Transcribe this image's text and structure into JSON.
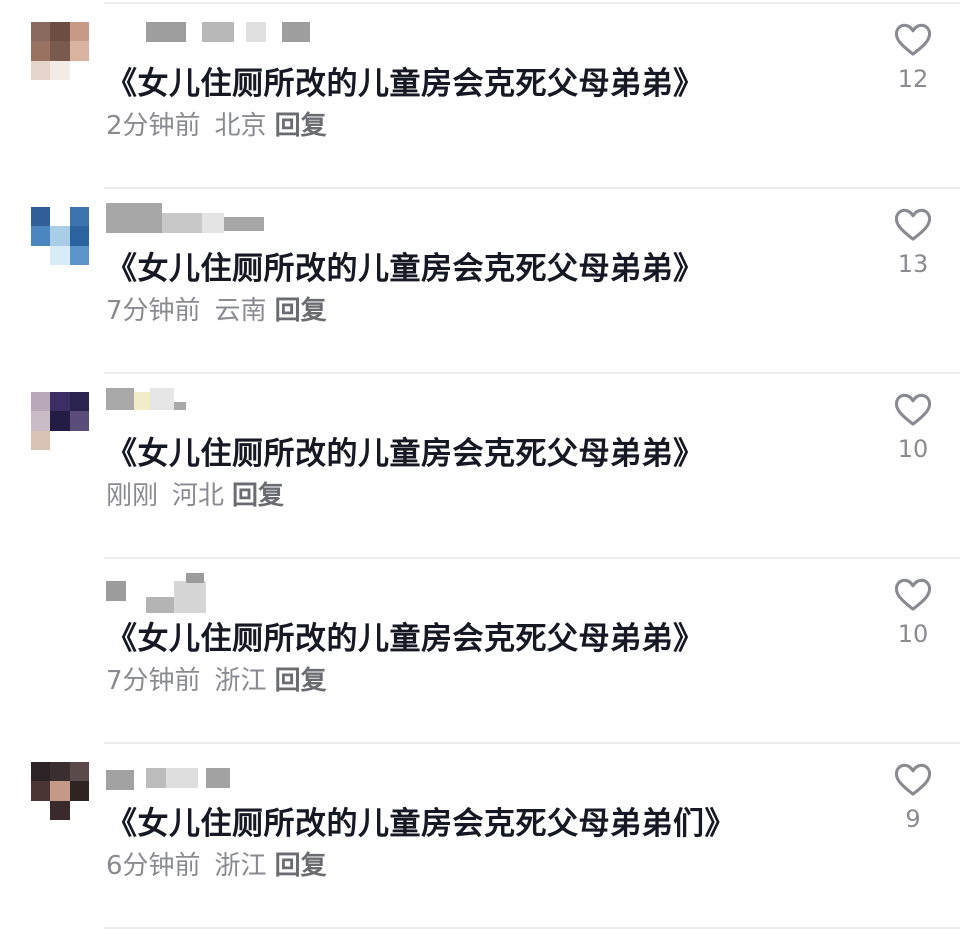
{
  "comments": [
    {
      "content": "《女儿住厕所改的儿童房会克死父母弟弟》",
      "time": "2分钟前",
      "location": "北京",
      "reply": "回复",
      "likes": "12",
      "icon": "heart-outline-icon",
      "avatar_colors": [
        "#8a6a5e",
        "#6e4e42",
        "#c79a86",
        "#9a7262",
        "#7a5a4e",
        "#d9b3a0",
        "#e6d5cc",
        "#f3ebe6",
        "#ffffff"
      ],
      "name_colors": [
        "#9e9e9e",
        "#b8b8b8",
        "#e0e0e0"
      ]
    },
    {
      "content": "《女儿住厕所改的儿童房会克死父母弟弟》",
      "time": "7分钟前",
      "location": "云南",
      "reply": "回复",
      "likes": "13",
      "icon": "heart-outline-icon",
      "avatar_colors": [
        "#2f5f96",
        "#ffffff",
        "#3c74ad",
        "#4b86c0",
        "#a9cde6",
        "#2b62a0",
        "#ffffff",
        "#d9ebf6",
        "#5c93c8"
      ],
      "name_colors": [
        "#a7a7a7",
        "#c8c8c8",
        "#e4e4e4"
      ]
    },
    {
      "content": "《女儿住厕所改的儿童房会克死父母弟弟》",
      "time": "刚刚",
      "location": "河北",
      "reply": "回复",
      "likes": "10",
      "icon": "heart-outline-icon",
      "avatar_colors": [
        "#b9a9b8",
        "#3b2e63",
        "#2a2350",
        "#c9bcc6",
        "#231c45",
        "#5a4d7a",
        "#d8c2b4",
        "#ffffff",
        "#ffffff"
      ],
      "name_colors": [
        "#a9a9a9",
        "#f2ecc8",
        "#e6e6e6"
      ]
    },
    {
      "content": "《女儿住厕所改的儿童房会克死父母弟弟》",
      "time": "7分钟前",
      "location": "浙江",
      "reply": "回复",
      "likes": "10",
      "icon": "heart-outline-icon",
      "avatar_colors": [
        "#ffffff",
        "#ffffff",
        "#ffffff",
        "#ffffff",
        "#ffffff",
        "#ffffff",
        "#ffffff",
        "#ffffff",
        "#ffffff"
      ],
      "name_colors": [
        "#9c9c9c",
        "#b4b4b4",
        "#d6d6d6"
      ]
    },
    {
      "content": "《女儿住厕所改的儿童房会克死父母弟弟们》",
      "time": "6分钟前",
      "location": "浙江",
      "reply": "回复",
      "likes": "9",
      "icon": "heart-outline-icon",
      "avatar_colors": [
        "#2b2326",
        "#3a2e30",
        "#5a4a4c",
        "#4a3434",
        "#c49a86",
        "#2e2424",
        "#ffffff",
        "#3a2a2c",
        "#ffffff"
      ],
      "name_colors": [
        "#a2a2a2",
        "#bcbcbc",
        "#dedede"
      ]
    }
  ]
}
